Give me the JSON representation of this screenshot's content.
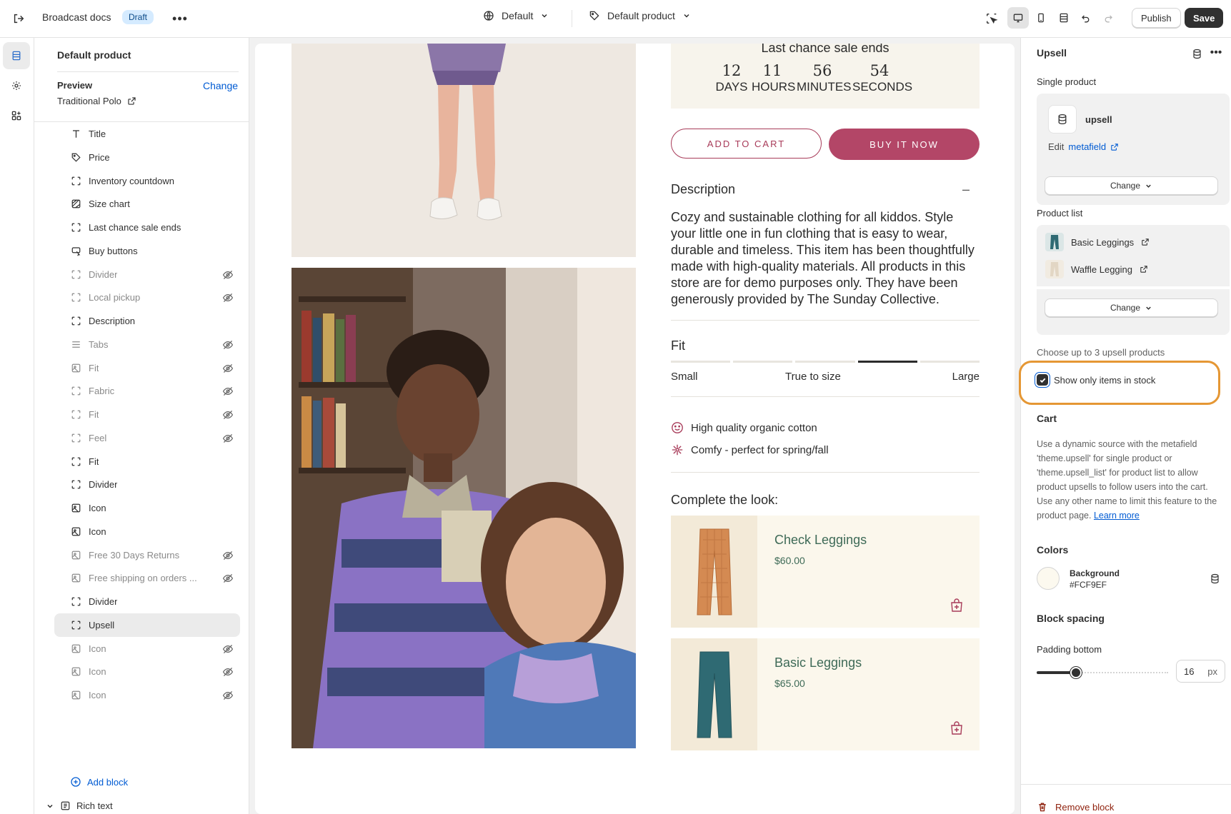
{
  "topbar": {
    "title": "Broadcast docs",
    "badge": "Draft",
    "theme_selector": "Default",
    "template_selector": "Default product",
    "publish_label": "Publish",
    "save_label": "Save"
  },
  "sidebar": {
    "heading": "Default product",
    "preview_label": "Preview",
    "change_label": "Change",
    "preview_value": "Traditional Polo",
    "blocks": [
      {
        "label": "Title",
        "icon": "title-icon",
        "hidden": false
      },
      {
        "label": "Price",
        "icon": "price-tag-icon",
        "hidden": false
      },
      {
        "label": "Inventory countdown",
        "icon": "block-frame-icon",
        "hidden": false
      },
      {
        "label": "Size chart",
        "icon": "size-chart-icon",
        "hidden": false
      },
      {
        "label": "Last chance sale ends",
        "icon": "block-frame-icon",
        "hidden": false
      },
      {
        "label": "Buy buttons",
        "icon": "buy-buttons-icon",
        "hidden": false
      },
      {
        "label": "Divider",
        "icon": "block-frame-icon",
        "hidden": true
      },
      {
        "label": "Local pickup",
        "icon": "block-frame-icon",
        "hidden": true
      },
      {
        "label": "Description",
        "icon": "block-frame-icon",
        "hidden": false
      },
      {
        "label": "Tabs",
        "icon": "lines-icon",
        "hidden": true
      },
      {
        "label": "Fit",
        "icon": "image-icon",
        "hidden": true
      },
      {
        "label": "Fabric",
        "icon": "block-frame-icon",
        "hidden": true
      },
      {
        "label": "Fit",
        "icon": "block-frame-icon",
        "hidden": true
      },
      {
        "label": "Feel",
        "icon": "block-frame-icon",
        "hidden": true
      },
      {
        "label": "Fit",
        "icon": "block-frame-icon",
        "hidden": false
      },
      {
        "label": "Divider",
        "icon": "block-frame-icon",
        "hidden": false
      },
      {
        "label": "Icon",
        "icon": "image-icon",
        "hidden": false
      },
      {
        "label": "Icon",
        "icon": "image-icon",
        "hidden": false
      },
      {
        "label": "Free 30 Days Returns",
        "icon": "image-icon",
        "hidden": true
      },
      {
        "label": "Free shipping on orders ...",
        "icon": "image-icon",
        "hidden": true
      },
      {
        "label": "Divider",
        "icon": "block-frame-icon",
        "hidden": false
      },
      {
        "label": "Upsell",
        "icon": "block-frame-icon",
        "hidden": false,
        "selected": true
      },
      {
        "label": "Icon",
        "icon": "image-icon",
        "hidden": true
      },
      {
        "label": "Icon",
        "icon": "image-icon",
        "hidden": true
      },
      {
        "label": "Icon",
        "icon": "image-icon",
        "hidden": true
      }
    ],
    "add_block": "Add block",
    "rich_text": "Rich text"
  },
  "preview": {
    "countdown": {
      "title": "Last chance sale ends",
      "units": [
        {
          "value": "12",
          "label": "DAYS"
        },
        {
          "value": "11",
          "label": "HOURS"
        },
        {
          "value": "56",
          "label": "MINUTES"
        },
        {
          "value": "54",
          "label": "SECONDS"
        }
      ]
    },
    "add_to_cart": "ADD TO CART",
    "buy_now": "BUY IT NOW",
    "description_heading": "Description",
    "description_toggle": "–",
    "description_body": "Cozy and sustainable clothing for all kiddos. Style your little one in fun clothing that is easy to wear, durable and timeless. This item has been thoughtfully made with high-quality materials. All products in this store are for demo purposes only. They have been generously provided by The Sunday Collective.",
    "fit": {
      "heading": "Fit",
      "labels": [
        "Small",
        "True to size",
        "Large"
      ],
      "active_segment": 4,
      "segments": 5
    },
    "features": [
      {
        "icon": "smiley-icon",
        "text": "High quality organic cotton"
      },
      {
        "icon": "flower-icon",
        "text": "Comfy - perfect for spring/fall"
      }
    ],
    "complete_look": {
      "heading": "Complete the look:",
      "items": [
        {
          "name": "Check Leggings",
          "price": "$60.00",
          "color": "#d48a52"
        },
        {
          "name": "Basic Leggings",
          "price": "$65.00",
          "color": "#2f6a73"
        }
      ]
    }
  },
  "right_panel": {
    "title": "Upsell",
    "single_product_label": "Single product",
    "single_product_value": "upsell",
    "edit_prefix": "Edit",
    "edit_link": "metafield",
    "change_label": "Change",
    "product_list_label": "Product list",
    "product_list": [
      {
        "name": "Basic Leggings",
        "color": "#2f6a73"
      },
      {
        "name": "Waffle Legging",
        "color": "#e2d6c4"
      }
    ],
    "choose_hint": "Choose up to 3 upsell products",
    "checkbox_label": "Show only items in stock",
    "checkbox_checked": true,
    "cart_heading": "Cart",
    "cart_help": "Use a dynamic source with the metafield 'theme.upsell' for single product or 'theme.upsell_list' for product list to allow product upsells to follow users into the cart. Use any other name to limit this feature to the product page.",
    "learn_more": "Learn more",
    "colors_heading": "Colors",
    "background_label": "Background",
    "background_value": "#FCF9EF",
    "block_spacing_heading": "Block spacing",
    "padding_label": "Padding bottom",
    "padding_value": "16",
    "padding_unit": "px",
    "padding_fraction": 0.3,
    "remove_block": "Remove block"
  },
  "colors": {
    "accent_link": "#005bd3",
    "buy_button": "#b34667",
    "highlight_ring": "#e59734"
  }
}
